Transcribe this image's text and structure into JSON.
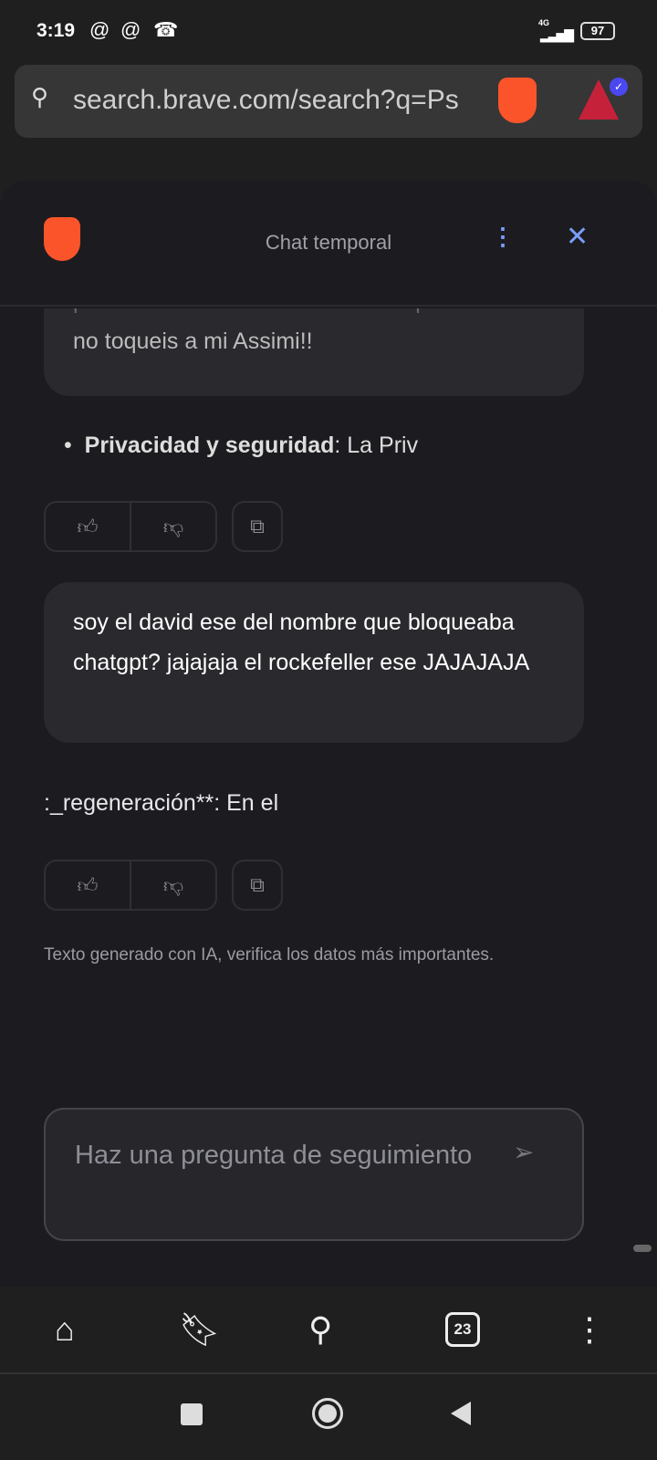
{
  "status": {
    "time": "3:19",
    "network": "4G",
    "battery": "97"
  },
  "urlbar": {
    "url": "search.brave.com/search?q=Ps"
  },
  "chat": {
    "title": "Chat temporal",
    "prev_bubble_partial": "puedes escribir con coherencia? que",
    "prev_bubble_last": "no toqueis a mi Assimi!!",
    "bullet_bold": "Privacidad y seguridad",
    "bullet_rest": ": La Priv",
    "user_message": "soy el david ese del nombre que bloqueaba chatgpt? jajajaja el rockefeller ese JAJAJAJA",
    "answer": ":_regeneración**: En el",
    "disclaimer": "Texto generado con IA, verifica los datos más importantes.",
    "input_placeholder": "Haz una pregunta de seguimiento"
  },
  "nav": {
    "tab_count": "23"
  },
  "colors": {
    "brave": "#fb542b",
    "accent": "#7c9dff"
  }
}
